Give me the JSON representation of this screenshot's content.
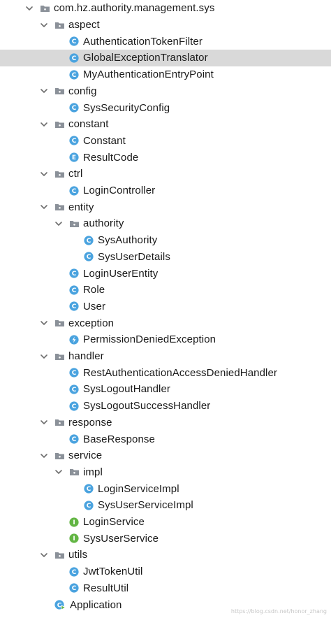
{
  "tree": [
    {
      "depth": 0,
      "type": "package",
      "expanded": true,
      "label": "com.hz.authority.management.sys"
    },
    {
      "depth": 1,
      "type": "package",
      "expanded": true,
      "label": "aspect"
    },
    {
      "depth": 2,
      "type": "class",
      "label": "AuthenticationTokenFilter"
    },
    {
      "depth": 2,
      "type": "class",
      "label": "GlobalExceptionTranslator",
      "selected": true
    },
    {
      "depth": 2,
      "type": "class",
      "label": "MyAuthenticationEntryPoint"
    },
    {
      "depth": 1,
      "type": "package",
      "expanded": true,
      "label": "config"
    },
    {
      "depth": 2,
      "type": "class",
      "label": "SysSecurityConfig"
    },
    {
      "depth": 1,
      "type": "package",
      "expanded": true,
      "label": "constant"
    },
    {
      "depth": 2,
      "type": "class",
      "label": "Constant"
    },
    {
      "depth": 2,
      "type": "enum",
      "label": "ResultCode"
    },
    {
      "depth": 1,
      "type": "package",
      "expanded": true,
      "label": "ctrl"
    },
    {
      "depth": 2,
      "type": "class",
      "label": "LoginController"
    },
    {
      "depth": 1,
      "type": "package",
      "expanded": true,
      "label": "entity"
    },
    {
      "depth": 2,
      "type": "package",
      "expanded": true,
      "label": "authority"
    },
    {
      "depth": 3,
      "type": "class",
      "label": "SysAuthority"
    },
    {
      "depth": 3,
      "type": "class",
      "label": "SysUserDetails"
    },
    {
      "depth": 2,
      "type": "class",
      "label": "LoginUserEntity"
    },
    {
      "depth": 2,
      "type": "class",
      "label": "Role"
    },
    {
      "depth": 2,
      "type": "class",
      "label": "User"
    },
    {
      "depth": 1,
      "type": "package",
      "expanded": true,
      "label": "exception"
    },
    {
      "depth": 2,
      "type": "exception",
      "label": "PermissionDeniedException"
    },
    {
      "depth": 1,
      "type": "package",
      "expanded": true,
      "label": "handler"
    },
    {
      "depth": 2,
      "type": "class",
      "label": "RestAuthenticationAccessDeniedHandler"
    },
    {
      "depth": 2,
      "type": "class",
      "label": "SysLogoutHandler"
    },
    {
      "depth": 2,
      "type": "class",
      "label": "SysLogoutSuccessHandler"
    },
    {
      "depth": 1,
      "type": "package",
      "expanded": true,
      "label": "response"
    },
    {
      "depth": 2,
      "type": "class",
      "label": "BaseResponse"
    },
    {
      "depth": 1,
      "type": "package",
      "expanded": true,
      "label": "service"
    },
    {
      "depth": 2,
      "type": "package",
      "expanded": true,
      "label": "impl"
    },
    {
      "depth": 3,
      "type": "class",
      "label": "LoginServiceImpl"
    },
    {
      "depth": 3,
      "type": "class",
      "label": "SysUserServiceImpl"
    },
    {
      "depth": 2,
      "type": "interface",
      "label": "LoginService"
    },
    {
      "depth": 2,
      "type": "interface",
      "label": "SysUserService"
    },
    {
      "depth": 1,
      "type": "package",
      "expanded": true,
      "label": "utils"
    },
    {
      "depth": 2,
      "type": "class",
      "label": "JwtTokenUtil"
    },
    {
      "depth": 2,
      "type": "class",
      "label": "ResultUtil"
    },
    {
      "depth": 1,
      "type": "application",
      "label": "Application"
    }
  ],
  "watermark": "https://blog.csdn.net/honor_zhang",
  "colors": {
    "class_icon": "#4aa3df",
    "enum_icon": "#4aa3df",
    "interface_icon": "#62b543",
    "exception_icon": "#4aa3df",
    "folder_icon": "#8b9199",
    "chevron": "#6e6e6e",
    "selected_row": "#d9d9d9"
  }
}
